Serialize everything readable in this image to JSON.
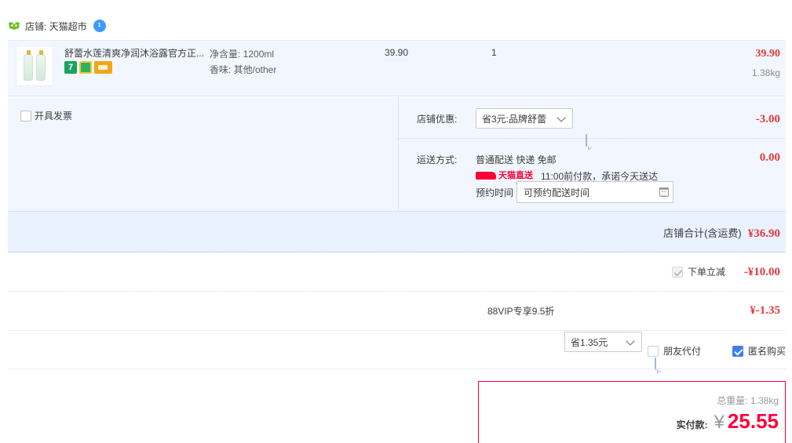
{
  "shop": {
    "label": "店铺: 天猫超市",
    "badge_text": "1"
  },
  "item": {
    "title": "舒蕾水莲清爽净润沐浴露官方正...",
    "specs": [
      "净含量: 1200ml",
      "香味: 其他/other"
    ],
    "unit_price": "39.90",
    "quantity": "1",
    "subtotal": "39.90",
    "weight": "1.38kg",
    "tags": [
      "7-day-return-icon",
      "guarantee-icon",
      "card-icon"
    ]
  },
  "invoice": {
    "label": "开具发票",
    "checked": false
  },
  "coupon": {
    "label": "店铺优惠:",
    "selected": "省3元:品牌舒蕾",
    "amount": "-3.00"
  },
  "shipping": {
    "label": "运送方式:",
    "method": "普通配送 快递 免邮",
    "tmall_direct": "天猫直送",
    "promise": "11:00前付款，承诺今天送达",
    "schedule_label": "预约时间",
    "schedule_placeholder": "可预约配送时间",
    "amount": "0.00"
  },
  "store_total": {
    "label": "店铺合计(含运费)",
    "amount": "¥36.90"
  },
  "discount": {
    "label": "下单立减",
    "amount": "-¥10.00",
    "checked": true
  },
  "vip": {
    "label": "88VIP专享9.5折",
    "selected": "省1.35元",
    "amount": "¥-1.35"
  },
  "options": {
    "friend_pay": "朋友代付",
    "friend_pay_checked": false,
    "anonymous": "匿名购买",
    "anonymous_checked": true
  },
  "summary": {
    "total_weight": "总重量: 1.38kg",
    "pay_label": "实付款:",
    "currency": "¥",
    "pay_amount": "25.55"
  },
  "colors": {
    "accent_red": "#e4393c",
    "pay_red": "#ff0036",
    "row_bg": "#f2f7ff",
    "check_blue": "#3d7df0"
  }
}
